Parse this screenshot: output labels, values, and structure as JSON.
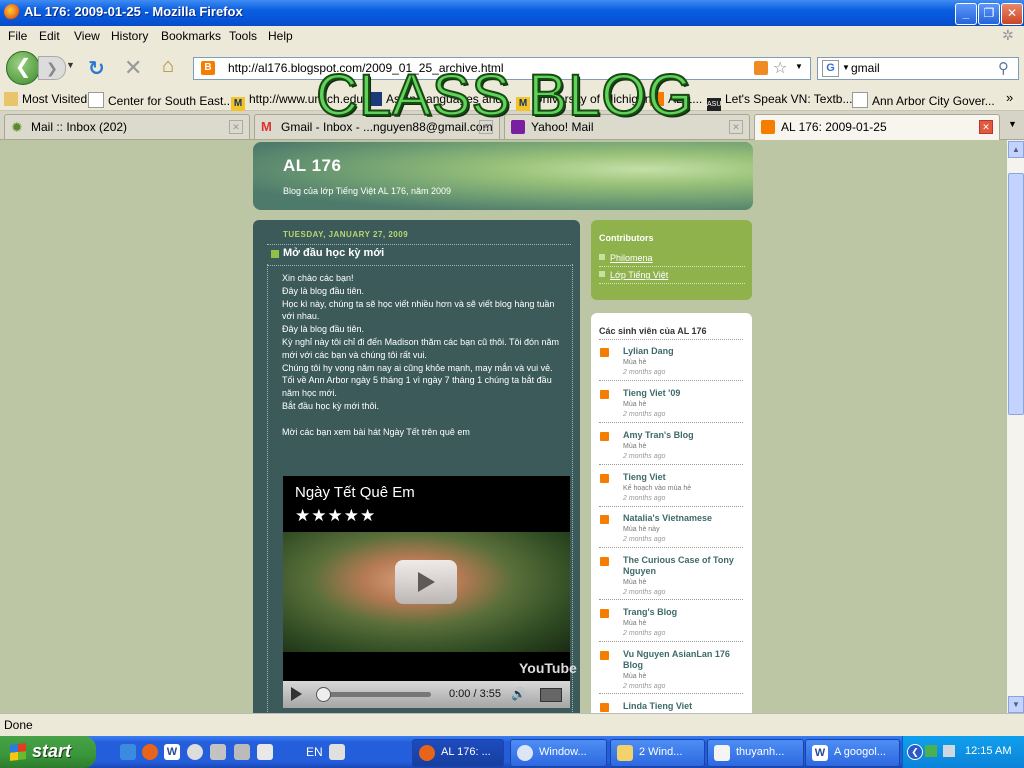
{
  "window": {
    "title": "AL 176: 2009-01-25 - Mozilla Firefox"
  },
  "menu": [
    "File",
    "Edit",
    "View",
    "History",
    "Bookmarks",
    "Tools",
    "Help"
  ],
  "nav": {
    "url": "http://al176.blogspot.com/2009_01_25_archive.html",
    "search_value": "gmail"
  },
  "bookmarks": [
    "Most Visited",
    "Center for South East...",
    "http://www.umich.edu...",
    "Asian Languages and...",
    "University of Michigan",
    "AL 1...",
    "Let's Speak VN: Textb...",
    "Ann Arbor City Gover..."
  ],
  "tabs": [
    {
      "label": "Mail :: Inbox (202)"
    },
    {
      "label": "Gmail - Inbox - ...nguyen88@gmail.com"
    },
    {
      "label": "Yahoo! Mail"
    },
    {
      "label": "AL 176: 2009-01-25"
    }
  ],
  "overlay_text": "CLASS BLOG",
  "blog": {
    "title": "AL 176",
    "description": "Blog của lớp Tiếng Việt AL 176, năm 2009",
    "post_date": "TUESDAY, JANUARY 27, 2009",
    "post_title": "Mở đầu học kỳ mới",
    "post_lines": [
      "Xin chào các bạn!",
      "Đây là blog đầu tiên.",
      "Học kì này, chúng ta sẽ học viết nhiều hơn và sẽ viết blog hàng tuần với nhau.",
      "Đây là blog đầu tiên.",
      "Kỳ nghỉ này tôi chỉ đi đến Madison thăm các bạn cũ thôi. Tôi đón năm mới với các bạn và chúng tôi rất vui.",
      "Chúng tôi hy vọng năm nay ai cũng khỏe mạnh, may mắn và vui vẻ.",
      "Tối về Ann Arbor ngày 5 tháng 1 vì ngày 7 tháng 1 chúng ta bắt đầu năm học mới.",
      "Bắt đầu học kỳ mới thôi.",
      "",
      "Mời các bạn xem bài hát Ngày Tết trên quê em"
    ],
    "video": {
      "title": "Ngày Tết Quê Em",
      "stars": "★★★★★",
      "time": "0:00 / 3:55",
      "logo": "YouTube"
    }
  },
  "sidebar": {
    "contributors_title": "Contributors",
    "contributors": [
      "Philomena",
      "Lớp Tiếng Việt"
    ],
    "students_title": "Các sinh viên của AL 176",
    "students": [
      {
        "name": "Lylian Dang",
        "sub": "Mùa hè",
        "age": "2 months ago"
      },
      {
        "name": "Tieng Viet '09",
        "sub": "Mùa hè",
        "age": "2 months ago"
      },
      {
        "name": "Amy Tran's Blog",
        "sub": "Mùa hè",
        "age": "2 months ago"
      },
      {
        "name": "Tieng Viet",
        "sub": "Kế hoạch vào mùa hè",
        "age": "2 months ago"
      },
      {
        "name": "Natalia's Vietnamese",
        "sub": "Mùa hè này",
        "age": "2 months ago"
      },
      {
        "name": "The Curious Case of Tony Nguyen",
        "sub": "Mùa hè",
        "age": "2 months ago"
      },
      {
        "name": "Trang's Blog",
        "sub": "Mùa hè",
        "age": "2 months ago"
      },
      {
        "name": "Vu Nguyen AsianLan 176 Blog",
        "sub": "Mùa hè",
        "age": "2 months ago"
      },
      {
        "name": "Linda Tieng Viet",
        "sub": "",
        "age": ""
      }
    ]
  },
  "status": "Done",
  "taskbar": {
    "start": "start",
    "lang": "EN",
    "items": [
      "AL 176: ...",
      "Window...",
      "2 Wind...",
      "thuyanh...",
      "A googol..."
    ],
    "clock": "12:15 AM"
  }
}
